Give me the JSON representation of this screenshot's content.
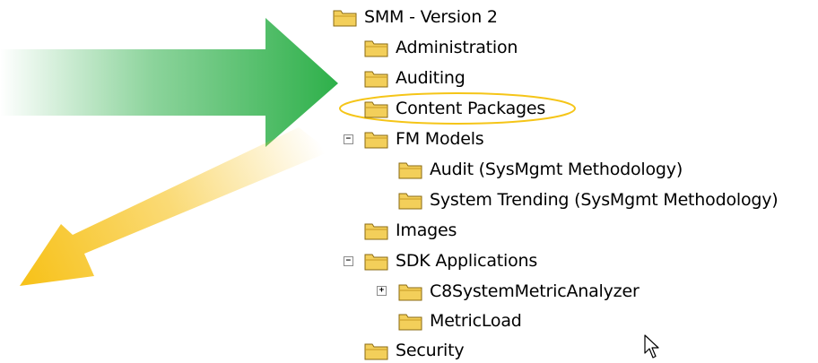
{
  "tree": {
    "items": [
      {
        "label": "SMM - Version 2"
      },
      {
        "label": "Administration"
      },
      {
        "label": "Auditing"
      },
      {
        "label": "Content Packages"
      },
      {
        "label": "FM Models",
        "expander": "−"
      },
      {
        "label": "Audit (SysMgmt Methodology)"
      },
      {
        "label": "System Trending (SysMgmt Methodology)"
      },
      {
        "label": "Images"
      },
      {
        "label": "SDK Applications",
        "expander": "−"
      },
      {
        "label": "C8SystemMetricAnalyzer",
        "expander": "+"
      },
      {
        "label": "MetricLoad"
      },
      {
        "label": "Security"
      }
    ]
  },
  "colors": {
    "green_arrow": "#2eb04a",
    "yellow_arrow": "#f7c21b",
    "highlight_ellipse": "#f5c518",
    "folder_fill": "#f3cf5a",
    "folder_dark": "#8a6a12"
  }
}
